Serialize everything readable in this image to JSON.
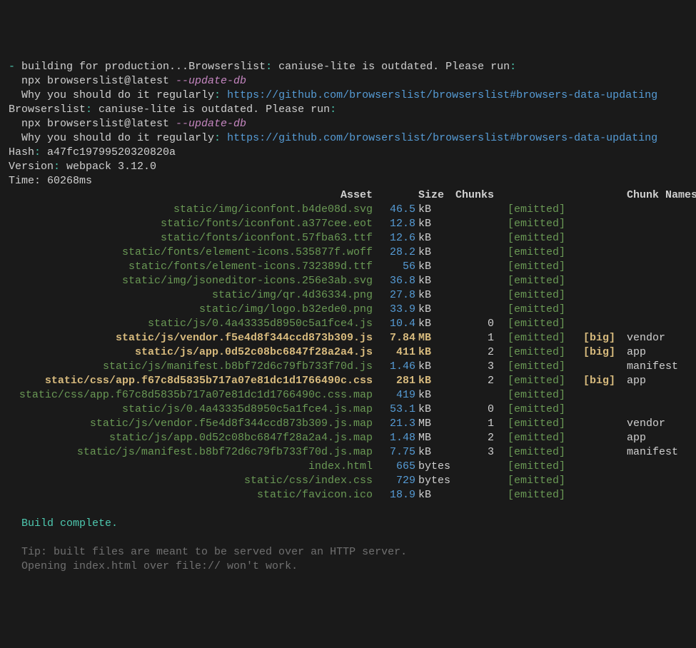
{
  "preamble": {
    "dash": "-",
    "building": " building for production...",
    "browserslist": "Browserslist",
    "colon": ":",
    "outdated_msg": " caniuse-lite is outdated. Please run",
    "npx_cmd": "  npx browserslist@latest ",
    "update_db": "--update-db",
    "why_regularly": "  Why you should do it regularly",
    "url": "https://github.com/browserslist/browserslist#browsers-data-updating",
    "hash_label": "Hash",
    "hash_value": " a47fc19799520320820a",
    "version_label": "Version",
    "version_value": " webpack 3.12.0",
    "time_line": "Time: 60268ms"
  },
  "headers": {
    "asset": "Asset",
    "size": "Size",
    "chunks": "Chunks",
    "chunk_names": "Chunk Names"
  },
  "rows": [
    {
      "asset": "static/img/iconfont.b4de08d.svg",
      "size": "46.5",
      "unit": "kB",
      "chunks": "",
      "big": "",
      "name": ""
    },
    {
      "asset": "static/fonts/iconfont.a377cee.eot",
      "size": "12.8",
      "unit": "kB",
      "chunks": "",
      "big": "",
      "name": ""
    },
    {
      "asset": "static/fonts/iconfont.57fba63.ttf",
      "size": "12.6",
      "unit": "kB",
      "chunks": "",
      "big": "",
      "name": ""
    },
    {
      "asset": "static/fonts/element-icons.535877f.woff",
      "size": "28.2",
      "unit": "kB",
      "chunks": "",
      "big": "",
      "name": ""
    },
    {
      "asset": "static/fonts/element-icons.732389d.ttf",
      "size": "56",
      "unit": "kB",
      "chunks": "",
      "big": "",
      "name": ""
    },
    {
      "asset": "static/img/jsoneditor-icons.256e3ab.svg",
      "size": "36.8",
      "unit": "kB",
      "chunks": "",
      "big": "",
      "name": ""
    },
    {
      "asset": "static/img/qr.4d36334.png",
      "size": "27.8",
      "unit": "kB",
      "chunks": "",
      "big": "",
      "name": ""
    },
    {
      "asset": "static/img/logo.b32ede0.png",
      "size": "33.9",
      "unit": "kB",
      "chunks": "",
      "big": "",
      "name": ""
    },
    {
      "asset": "static/js/0.4a43335d8950c5a1fce4.js",
      "size": "10.4",
      "unit": "kB",
      "chunks": "0",
      "big": "",
      "name": ""
    },
    {
      "asset": "static/js/vendor.f5e4d8f344ccd873b309.js",
      "size": "7.84",
      "unit": "MB",
      "chunks": "1",
      "big": "[big]",
      "name": "vendor",
      "bigstyle": true
    },
    {
      "asset": "static/js/app.0d52c08bc6847f28a2a4.js",
      "size": "411",
      "unit": "kB",
      "chunks": "2",
      "big": "[big]",
      "name": "app",
      "bigstyle": true
    },
    {
      "asset": "static/js/manifest.b8bf72d6c79fb733f70d.js",
      "size": "1.46",
      "unit": "kB",
      "chunks": "3",
      "big": "",
      "name": "manifest"
    },
    {
      "asset": "static/css/app.f67c8d5835b717a07e81dc1d1766490c.css",
      "size": "281",
      "unit": "kB",
      "chunks": "2",
      "big": "[big]",
      "name": "app",
      "bigstyle": true
    },
    {
      "asset": "static/css/app.f67c8d5835b717a07e81dc1d1766490c.css.map",
      "size": "419",
      "unit": "kB",
      "chunks": "",
      "big": "",
      "name": ""
    },
    {
      "asset": "static/js/0.4a43335d8950c5a1fce4.js.map",
      "size": "53.1",
      "unit": "kB",
      "chunks": "0",
      "big": "",
      "name": ""
    },
    {
      "asset": "static/js/vendor.f5e4d8f344ccd873b309.js.map",
      "size": "21.3",
      "unit": "MB",
      "chunks": "1",
      "big": "",
      "name": "vendor"
    },
    {
      "asset": "static/js/app.0d52c08bc6847f28a2a4.js.map",
      "size": "1.48",
      "unit": "MB",
      "chunks": "2",
      "big": "",
      "name": "app"
    },
    {
      "asset": "static/js/manifest.b8bf72d6c79fb733f70d.js.map",
      "size": "7.75",
      "unit": "kB",
      "chunks": "3",
      "big": "",
      "name": "manifest"
    },
    {
      "asset": "index.html",
      "size": "665",
      "unit": "bytes",
      "chunks": "",
      "big": "",
      "name": ""
    },
    {
      "asset": "static/css/index.css",
      "size": "729",
      "unit": "bytes",
      "chunks": "",
      "big": "",
      "name": ""
    },
    {
      "asset": "static/favicon.ico",
      "size": "18.9",
      "unit": "kB",
      "chunks": "",
      "big": "",
      "name": ""
    }
  ],
  "emitted": "[emitted]",
  "footer": {
    "blank": "",
    "complete": "  Build complete.",
    "tip1": "  Tip: built files are meant to be served over an HTTP server.",
    "tip2": "  Opening index.html over file:// won't work."
  }
}
